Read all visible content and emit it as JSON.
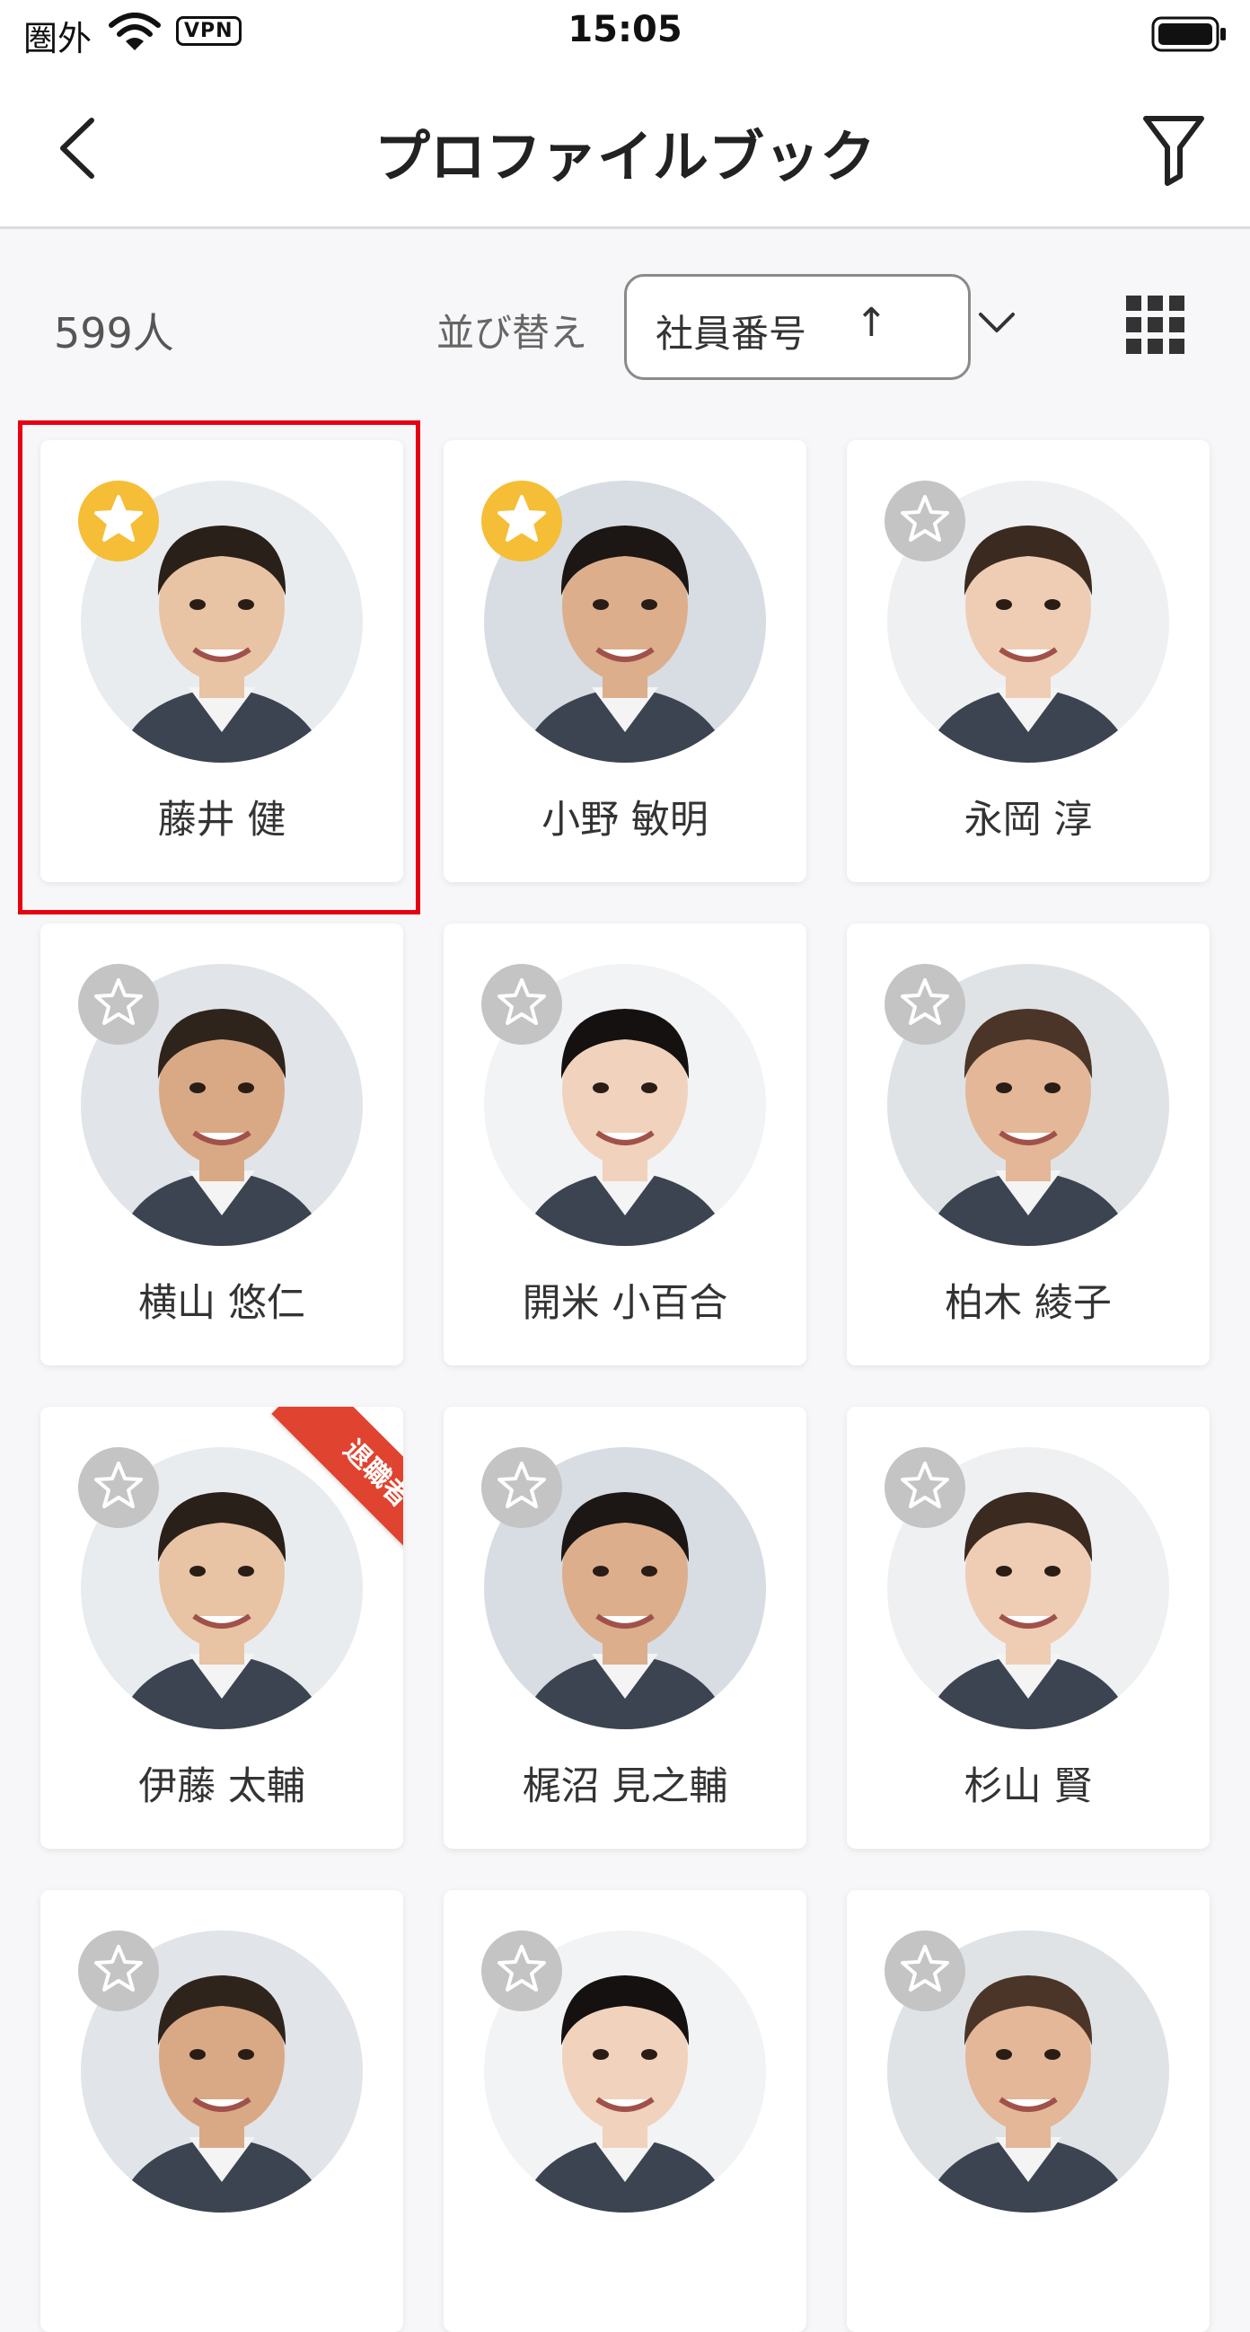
{
  "status_bar": {
    "carrier": "圏外",
    "vpn": "VPN",
    "time": "15:05"
  },
  "nav": {
    "title": "プロファイルブック",
    "back_icon": "chevron-left-icon",
    "filter_icon": "filter-icon"
  },
  "toolbar": {
    "count": "599人",
    "sort_label": "並び替え",
    "sort_value": "社員番号",
    "sort_direction": "↑",
    "grid_icon": "grid-view-icon"
  },
  "colors": {
    "favorite_on": "#f5be36",
    "favorite_off": "#c4c4c4",
    "retired_ribbon": "#e0432f",
    "selection": "#e60012"
  },
  "profiles": [
    {
      "name": "藤井 健",
      "favorite": true,
      "retired": false,
      "selected": true
    },
    {
      "name": "小野 敏明",
      "favorite": true,
      "retired": false,
      "selected": false
    },
    {
      "name": "永岡 淳",
      "favorite": false,
      "retired": false,
      "selected": false
    },
    {
      "name": "横山 悠仁",
      "favorite": false,
      "retired": false,
      "selected": false
    },
    {
      "name": "開米 小百合",
      "favorite": false,
      "retired": false,
      "selected": false
    },
    {
      "name": "柏木 綾子",
      "favorite": false,
      "retired": false,
      "selected": false
    },
    {
      "name": "伊藤 太輔",
      "favorite": false,
      "retired": true,
      "retired_label": "退職者",
      "selected": false
    },
    {
      "name": "梶沼 見之輔",
      "favorite": false,
      "retired": false,
      "selected": false
    },
    {
      "name": "杉山 賢",
      "favorite": false,
      "retired": false,
      "selected": false
    },
    {
      "name": "",
      "favorite": false,
      "retired": false,
      "selected": false
    },
    {
      "name": "",
      "favorite": false,
      "retired": false,
      "selected": false
    },
    {
      "name": "",
      "favorite": false,
      "retired": false,
      "selected": false
    }
  ]
}
